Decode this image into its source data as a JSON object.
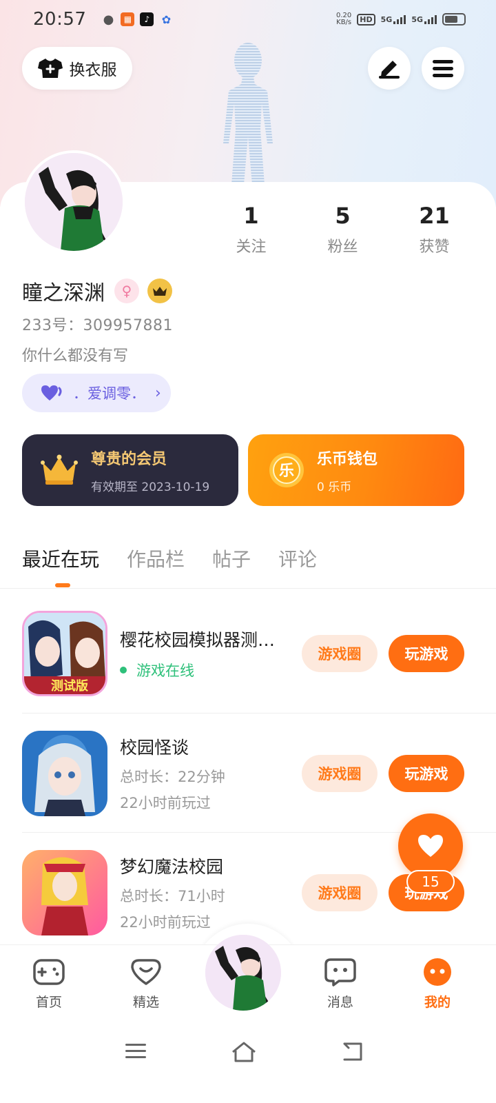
{
  "status_bar": {
    "time": "20:57",
    "net_speed_value": "0.20",
    "net_speed_unit": "KB/s",
    "hd": "HD",
    "signal1": "5G",
    "signal2": "5G"
  },
  "header": {
    "wardrobe_label": "换衣服",
    "icons": [
      "tshirt-icon",
      "edit-icon",
      "menu-icon"
    ]
  },
  "stats": [
    {
      "value": "1",
      "label": "关注"
    },
    {
      "value": "5",
      "label": "粉丝"
    },
    {
      "value": "21",
      "label": "获赞"
    }
  ],
  "profile": {
    "username": "瞳之深渊",
    "uid": "233号：309957881",
    "bio": "你什么都没有写",
    "tag": "．爱调零．"
  },
  "vip": {
    "title": "尊贵的会员",
    "subtitle": "有效期至  2023-10-19"
  },
  "wallet": {
    "title": "乐币钱包",
    "subtitle": "0  乐币",
    "coin_char": "乐"
  },
  "tabs": [
    {
      "label": "最近在玩",
      "active": true
    },
    {
      "label": "作品栏",
      "active": false
    },
    {
      "label": "帖子",
      "active": false
    },
    {
      "label": "评论",
      "active": false
    }
  ],
  "games": [
    {
      "title": "樱花校园模拟器测…",
      "status": "游戏在线",
      "circle_label": "游戏圈",
      "play_label": "玩游戏",
      "badge": "测试版"
    },
    {
      "title": "校园怪谈",
      "duration": "总时长：22分钟",
      "last_played": "22小时前玩过",
      "circle_label": "游戏圈",
      "play_label": "玩游戏"
    },
    {
      "title": "梦幻魔法校园",
      "duration": "总时长：71小时",
      "last_played": "22小时前玩过",
      "circle_label": "游戏圈",
      "play_label": "玩游戏"
    }
  ],
  "fab": {
    "count": "15"
  },
  "bottom_nav": [
    {
      "label": "首页",
      "icon": "gamepad-icon"
    },
    {
      "label": "精选",
      "icon": "heart-tv-icon"
    },
    {
      "label": "消息",
      "icon": "chat-icon"
    },
    {
      "label": "我的",
      "icon": "face-icon",
      "active": true
    }
  ],
  "colors": {
    "accent": "#ff6e12",
    "vip_bg": "#2b2a3d",
    "vip_text": "#f5c873",
    "online": "#2ec07a",
    "tag_text": "#6a5fe0"
  }
}
